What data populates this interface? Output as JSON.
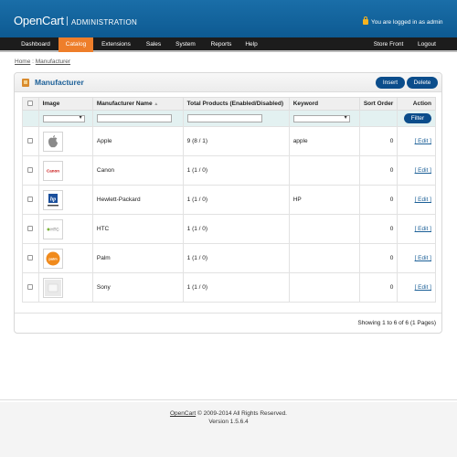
{
  "header": {
    "logo": "OpenCart",
    "section": "ADMINISTRATION",
    "logged_in": "You are logged in as admin"
  },
  "nav": {
    "items": [
      "Dashboard",
      "Catalog",
      "Extensions",
      "Sales",
      "System",
      "Reports",
      "Help"
    ],
    "active": "Catalog",
    "right": [
      "Store Front",
      "Logout"
    ]
  },
  "breadcrumb": {
    "home": "Home",
    "sep": " : ",
    "current": "Manufacturer"
  },
  "box": {
    "title": "Manufacturer",
    "insert": "Insert",
    "delete": "Delete"
  },
  "table": {
    "columns": [
      "Image",
      "Manufacturer Name",
      "Total Products (Enabled/Disabled)",
      "Keyword",
      "Sort Order",
      "Action"
    ],
    "sort_arrow": "▲",
    "filter_label": "Filter",
    "rows": [
      {
        "name": "Apple",
        "total": "9 (8 / 1)",
        "keyword": "apple",
        "sort": "0",
        "action": "[ Edit ]",
        "logo": "apple-logo"
      },
      {
        "name": "Canon",
        "total": "1 (1 / 0)",
        "keyword": "",
        "sort": "0",
        "action": "[ Edit ]",
        "logo": "canon-logo"
      },
      {
        "name": "Hewlett-Packard",
        "total": "1 (1 / 0)",
        "keyword": "HP",
        "sort": "0",
        "action": "[ Edit ]",
        "logo": "hp-logo"
      },
      {
        "name": "HTC",
        "total": "1 (1 / 0)",
        "keyword": "",
        "sort": "0",
        "action": "[ Edit ]",
        "logo": "htc-logo"
      },
      {
        "name": "Palm",
        "total": "1 (1 / 0)",
        "keyword": "",
        "sort": "0",
        "action": "[ Edit ]",
        "logo": "palm-logo"
      },
      {
        "name": "Sony",
        "total": "1 (1 / 0)",
        "keyword": "",
        "sort": "0",
        "action": "[ Edit ]",
        "logo": "sony-logo"
      }
    ]
  },
  "pagination": "Showing 1 to 6 of 6 (1 Pages)",
  "footer": {
    "link": "OpenCart",
    "copyright": " © 2009-2014 All Rights Reserved.",
    "version": "Version 1.5.6.4"
  },
  "colors": {
    "header": "#0d5a92",
    "nav_active": "#ee7e2a",
    "button": "#0b4d8b",
    "title": "#1b5f97"
  }
}
